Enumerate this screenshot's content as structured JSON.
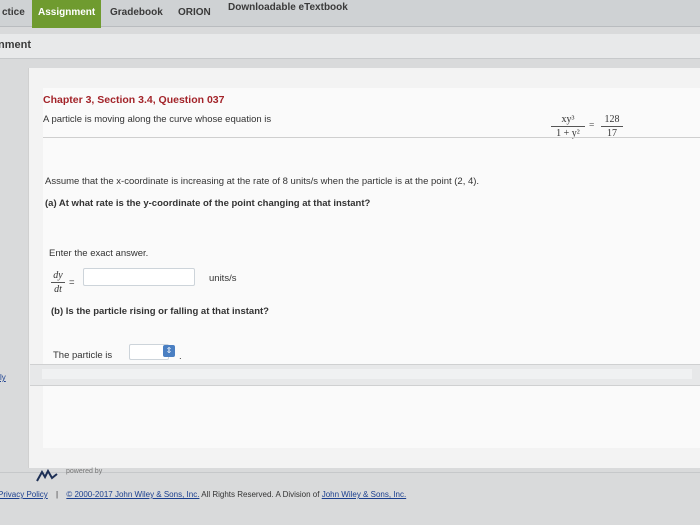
{
  "nav": {
    "tabs": [
      {
        "label": "ctice",
        "active": false
      },
      {
        "label": "Assignment",
        "active": true
      },
      {
        "label": "Gradebook",
        "active": false
      },
      {
        "label": "ORION",
        "active": false
      },
      {
        "label": "Downloadable eTextbook",
        "active": false
      }
    ]
  },
  "subbar": {
    "title": "nment"
  },
  "question": {
    "header": "Chapter 3, Section 3.4, Question 037",
    "intro": "A particle is moving along the curve whose equation is",
    "equation": {
      "lhs_num": "xy³",
      "lhs_den": "1 + y²",
      "eq": "=",
      "rhs_num": "128",
      "rhs_den": "17"
    },
    "assume_text": "Assume that the x-coordinate is increasing at the rate of 8 units/s when the particle is at the point (2, 4).",
    "part_a": "(a) At what rate is the y-coordinate of the point changing at that instant?",
    "enter_exact": "Enter the exact answer.",
    "dy_num": "dy",
    "dy_den": "dt",
    "eq_sign": "=",
    "dy_value": "",
    "units": "units/s",
    "part_b": "(b) Is the particle rising or falling at that instant?",
    "particle_is": "The particle is",
    "particle_select_value": "",
    "period": "."
  },
  "sidebar": {
    "link": "ly"
  },
  "footer": {
    "powered_by": "powered by",
    "privacy": "Privacy Policy",
    "separator": "|",
    "copyright_prefix": "© 2000-2017 John Wiley & Sons, Inc.",
    "rights": " All Rights Reserved. A Division of ",
    "company_link": "John Wiley & Sons, Inc."
  },
  "colors": {
    "accent": "#6f9b2f",
    "header_red": "#a3242a",
    "link_blue": "#1b3f8f",
    "select_blue": "#4a7fc2"
  }
}
